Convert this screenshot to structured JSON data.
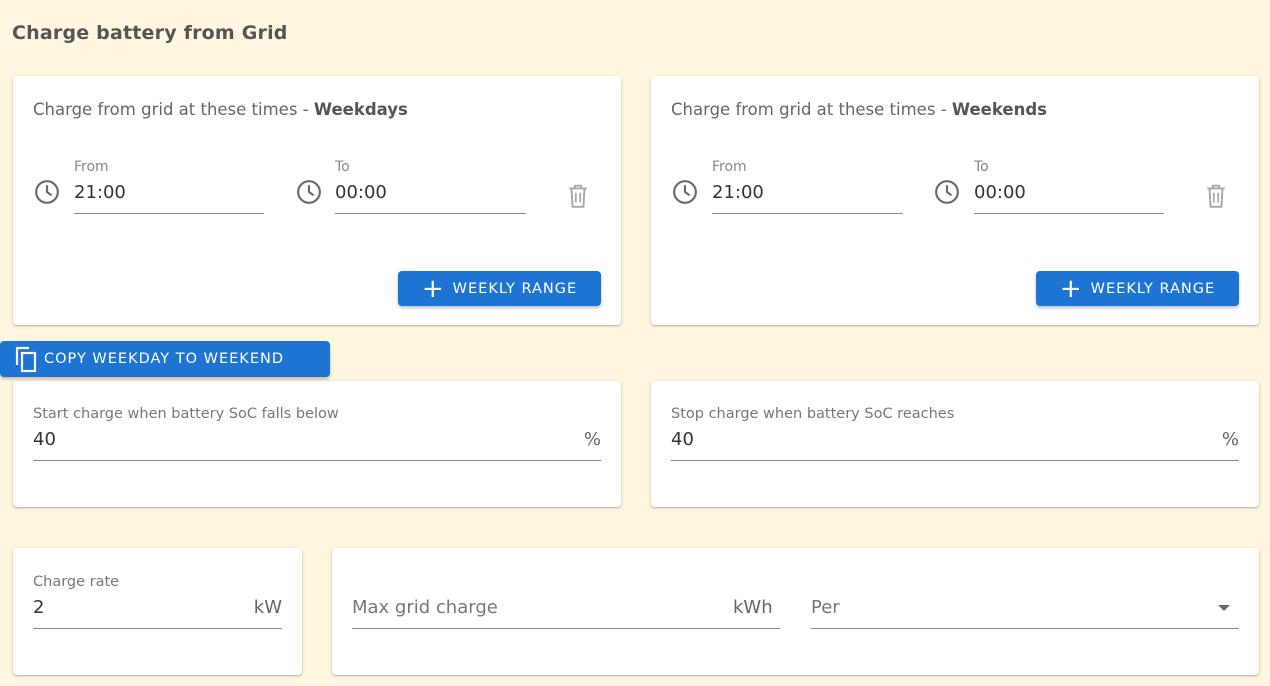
{
  "page": {
    "title": "Charge battery from Grid"
  },
  "weekdays": {
    "heading_prefix": "Charge from grid at these times - ",
    "heading_bold": "Weekdays",
    "from_label": "From",
    "from_value": "21:00",
    "to_label": "To",
    "to_value": "00:00",
    "add_button": "WEEKLY RANGE"
  },
  "weekends": {
    "heading_prefix": "Charge from grid at these times - ",
    "heading_bold": "Weekends",
    "from_label": "From",
    "from_value": "21:00",
    "to_label": "To",
    "to_value": "00:00",
    "add_button": "WEEKLY RANGE"
  },
  "copy_button": {
    "label": "COPY WEEKDAY TO WEEKEND"
  },
  "start_charge": {
    "label": "Start charge when battery SoC falls below",
    "value": "40",
    "unit": "%"
  },
  "stop_charge": {
    "label": "Stop charge when battery SoC reaches",
    "value": "40",
    "unit": "%"
  },
  "charge_rate": {
    "label": "Charge rate",
    "value": "2",
    "unit": "kW"
  },
  "max_grid_charge": {
    "placeholder": "Max grid charge",
    "unit": "kWh"
  },
  "per_select": {
    "placeholder": "Per"
  },
  "colors": {
    "background": "#fef6df",
    "accent": "#1e74d3",
    "card": "#ffffff"
  },
  "icons": {
    "clock": "clock-icon",
    "trash": "trash-icon",
    "plus": "plus-icon",
    "copy": "copy-icon",
    "dropdown": "chevron-down-icon"
  }
}
